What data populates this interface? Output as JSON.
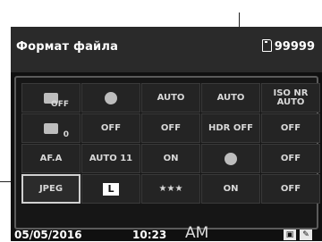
{
  "title": "Формат файла",
  "shots_remaining": "99999",
  "grid": [
    [
      "OFF",
      "",
      "AUTO",
      "AUTO",
      "ISO NR AUTO"
    ],
    [
      "0",
      "OFF",
      "OFF",
      "HDR OFF",
      "OFF"
    ],
    [
      "AF.A",
      "AUTO 11",
      "ON",
      "",
      "OFF"
    ],
    [
      "JPEG",
      "L",
      "★★★",
      "ON",
      "OFF"
    ]
  ],
  "date": "05/05/2016",
  "time": "10:23",
  "ampm": "AM",
  "icons": [
    "sd-card-icon",
    "camera-setting-icon",
    "wrench-icon"
  ]
}
